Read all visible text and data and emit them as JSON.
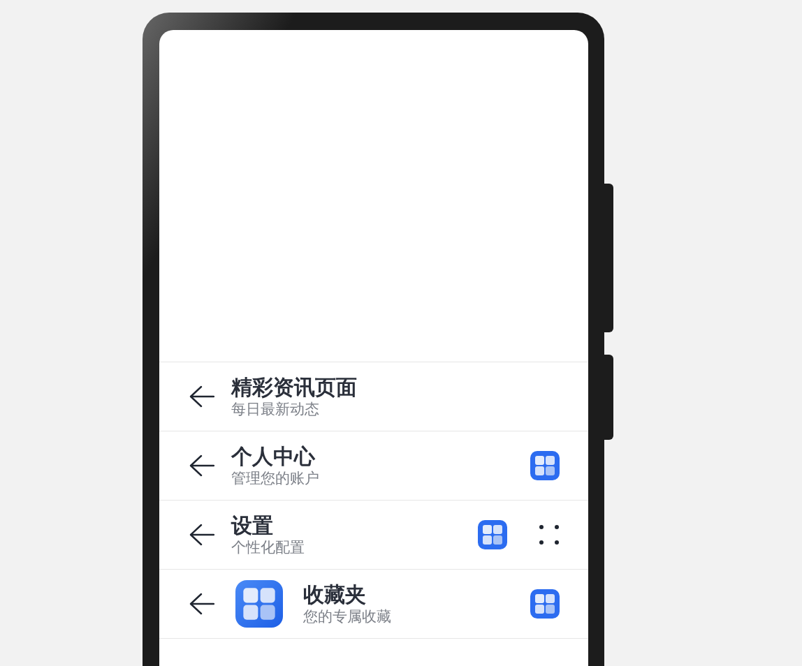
{
  "rows": [
    {
      "title": "精彩资讯页面",
      "subtitle": "每日最新动态",
      "trailing_icons": []
    },
    {
      "title": "个人中心",
      "subtitle": "管理您的账户",
      "trailing_icons": [
        {
          "kind": "app"
        }
      ]
    },
    {
      "title": "设置",
      "subtitle": "个性化配置",
      "trailing_icons": [
        {
          "kind": "app"
        },
        {
          "kind": "more"
        }
      ]
    },
    {
      "title": "收藏夹",
      "subtitle": "您的专属收藏",
      "leading_icon": {
        "kind": "app"
      },
      "trailing_icons": [
        {
          "kind": "app"
        }
      ]
    }
  ]
}
